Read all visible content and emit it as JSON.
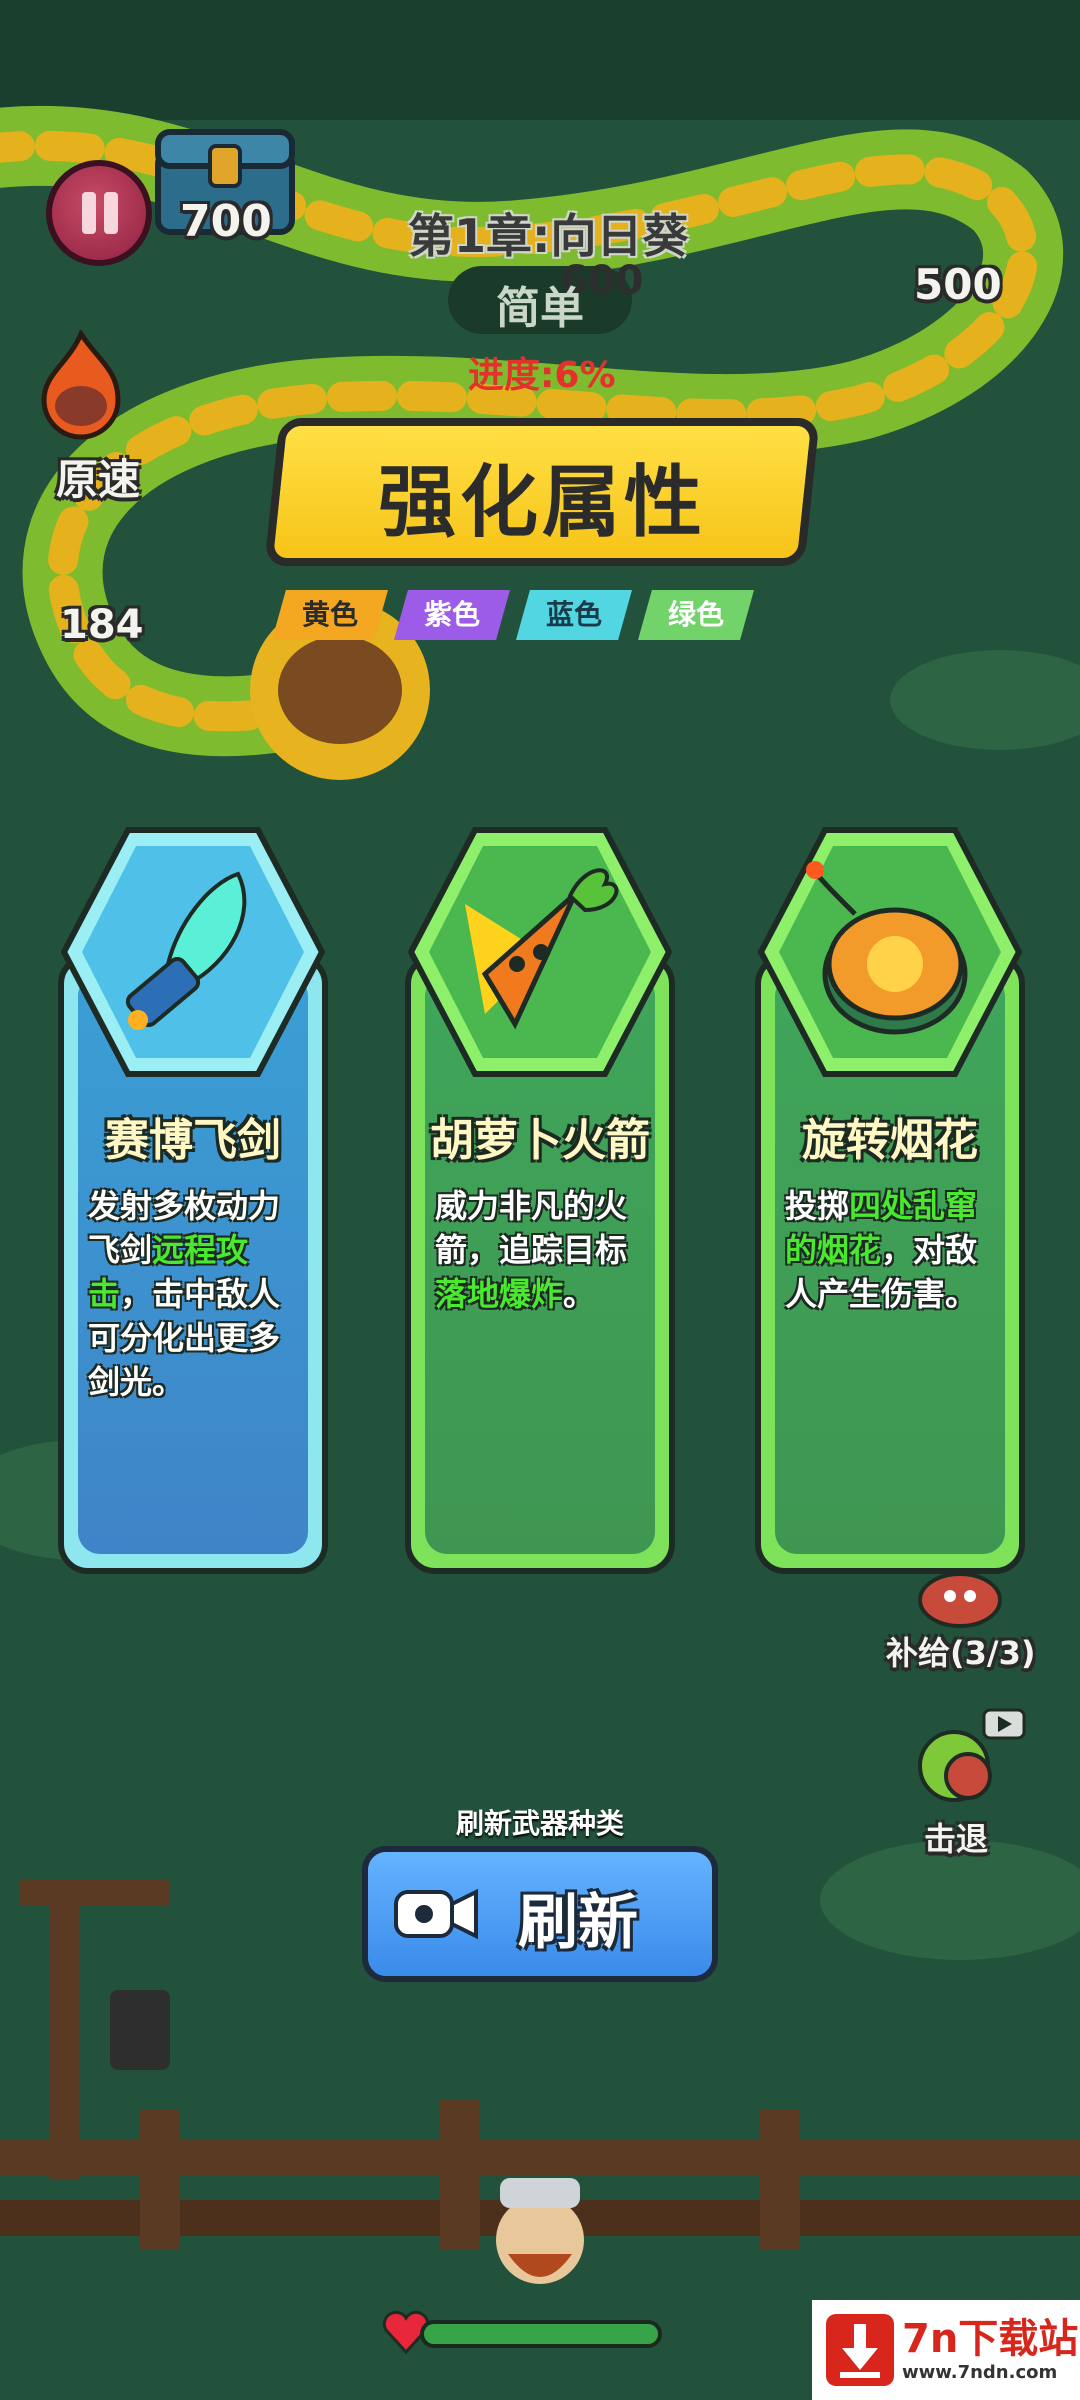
{
  "hud": {
    "coins": "700",
    "chapter_title": "第1章:向日葵",
    "difficulty": "简单",
    "progress": "进度:6%",
    "speed_label": "原速",
    "wave_values": [
      "600",
      "500",
      "184"
    ]
  },
  "banner": {
    "title": "强化属性",
    "tags": [
      "黄色",
      "紫色",
      "蓝色",
      "绿色"
    ]
  },
  "cards": [
    {
      "name": "赛博飞剑",
      "desc_pre": "发射多枚动力飞剑",
      "desc_hl": "远程攻击",
      "desc_post": "，击中敌人可分化出更多剑光。",
      "icon": "cyber-sword-icon"
    },
    {
      "name": "胡萝卜火箭",
      "desc_pre": "威力非凡的火箭，追踪目标",
      "desc_hl": "落地爆炸",
      "desc_post": "。",
      "icon": "carrot-rocket-icon"
    },
    {
      "name": "旋转烟花",
      "desc_pre": "投掷",
      "desc_hl": "四处乱窜的烟花",
      "desc_post": "，对敌人产生伤害。",
      "icon": "spinning-firework-icon"
    }
  ],
  "side": {
    "supply_label": "补给(3/3)",
    "repel_label": "击退"
  },
  "refresh": {
    "caption": "刷新武器种类",
    "label": "刷新"
  },
  "player": {
    "health_fraction": 1.0
  },
  "watermark": {
    "main": "7n下载站",
    "sub": "www.7ndn.com"
  },
  "colors": {
    "highlight": "#4be830",
    "banner_yellow": "#f7c418",
    "progress_red": "#e2322b"
  }
}
